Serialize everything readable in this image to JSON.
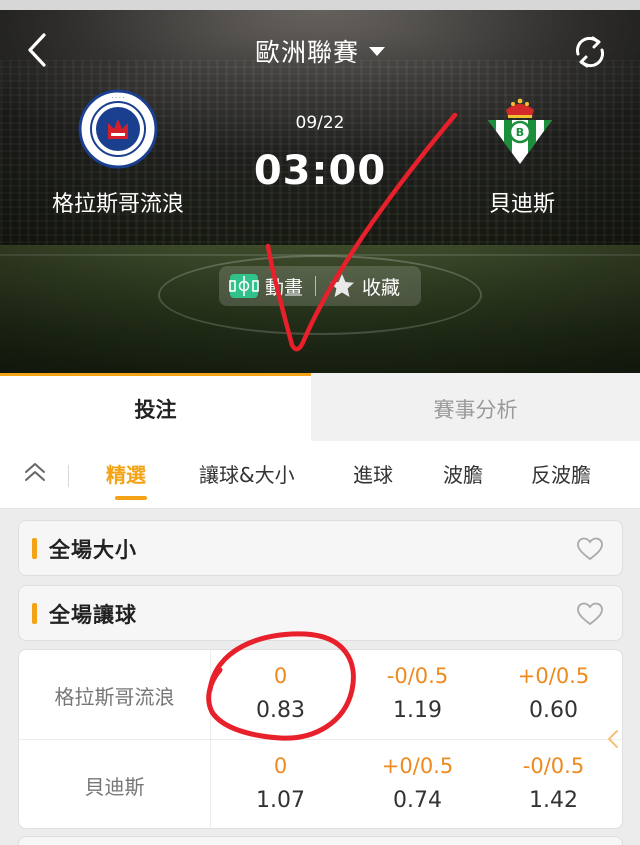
{
  "header": {
    "title": "歐洲聯賽",
    "back_icon": "chevron-left-icon",
    "dropdown_icon": "caret-down-icon",
    "refresh_icon": "refresh-icon"
  },
  "match": {
    "date": "09/22",
    "time": "03:00",
    "home": {
      "name": "格拉斯哥流浪",
      "logo": "rangers-crest-logo"
    },
    "away": {
      "name": "貝迪斯",
      "logo": "real-betis-crest-logo"
    }
  },
  "actions": {
    "animation_label": "動畫",
    "favorite_label": "收藏",
    "animation_icon": "pitch-icon",
    "favorite_icon": "star-icon"
  },
  "main_tabs": [
    {
      "label": "投注",
      "active": true
    },
    {
      "label": "賽事分析",
      "active": false
    }
  ],
  "sub_tabs": [
    {
      "label": "精選",
      "active": true
    },
    {
      "label": "讓球&大小",
      "active": false
    },
    {
      "label": "進球",
      "active": false
    },
    {
      "label": "波膽",
      "active": false
    },
    {
      "label": "反波膽",
      "active": false
    }
  ],
  "sections": [
    {
      "title": "全場大小",
      "expanded": false
    },
    {
      "title": "全場讓球",
      "expanded": true
    }
  ],
  "handicap_rows": [
    {
      "team": "格拉斯哥流浪",
      "odds": [
        {
          "line": "0",
          "price": "0.83"
        },
        {
          "line": "-0/0.5",
          "price": "1.19"
        },
        {
          "line": "+0/0.5",
          "price": "0.60"
        }
      ]
    },
    {
      "team": "貝迪斯",
      "odds": [
        {
          "line": "0",
          "price": "1.07"
        },
        {
          "line": "+0/0.5",
          "price": "0.74"
        },
        {
          "line": "-0/0.5",
          "price": "1.42"
        }
      ]
    }
  ],
  "colors": {
    "accent": "#f3a315",
    "odds_line": "#ee8a1e",
    "annotation": "#e8202b"
  }
}
